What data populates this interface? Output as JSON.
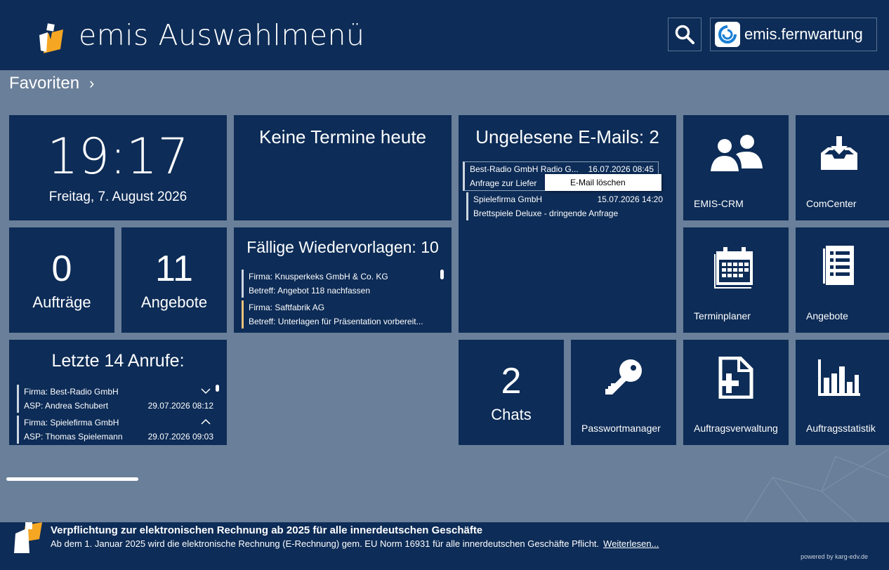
{
  "header": {
    "title": "emis Auswahlmenü",
    "fernwartung_label": "emis.fernwartung"
  },
  "favorites": {
    "label": "Favoriten",
    "chevron": "›"
  },
  "clock": {
    "time": "19:17",
    "date": "Freitag, 7. August 2026"
  },
  "termine": {
    "title": "Keine Termine heute"
  },
  "emails": {
    "title": "Ungelesene E-Mails: 2",
    "items": [
      {
        "from": "Best-Radio GmbH Radio G...",
        "date": "16.07.2026 08:45",
        "subject": "Anfrage zur Liefer"
      },
      {
        "from": "Spielefirma GmbH",
        "date": "15.07.2026 14:20",
        "subject": "Brettspiele Deluxe - dringende Anfrage"
      }
    ],
    "context_menu": "E-Mail löschen"
  },
  "auftraege": {
    "count": "0",
    "label": "Aufträge"
  },
  "angebote_count": {
    "count": "11",
    "label": "Angebote"
  },
  "wiedervorlagen": {
    "title": "Fällige Wiedervorlagen: 10",
    "items": [
      {
        "firma": "Firma: Knusperkeks GmbH & Co. KG",
        "betreff": "Betreff: Angebot 118 nachfassen",
        "color": "#ced6e0"
      },
      {
        "firma": "Firma: Saftfabrik AG",
        "betreff": "Betreff: Unterlagen für Präsentation vorbereit...",
        "color": "#f0c27a"
      }
    ]
  },
  "anrufe": {
    "title": "Letzte 14 Anrufe:",
    "items": [
      {
        "firma": "Firma: Best-Radio GmbH",
        "asp": "ASP: Andrea Schubert",
        "date": "29.07.2026 08:12",
        "chevron": "down"
      },
      {
        "firma": "Firma: Spielefirma GmbH",
        "asp": "ASP: Thomas Spielemann",
        "date": "29.07.2026 09:03",
        "chevron": "up"
      }
    ]
  },
  "chats": {
    "count": "2",
    "label": "Chats"
  },
  "apps": {
    "crm": "EMIS-CRM",
    "comcenter": "ComCenter",
    "terminplaner": "Terminplaner",
    "angebote": "Angebote",
    "passwort": "Passwortmanager",
    "auftragsverwaltung": "Auftragsverwaltung",
    "auftragsstatistik": "Auftragsstatistik"
  },
  "footer": {
    "title": "Verpflichtung zur elektronischen Rechnung ab 2025 für alle innerdeutschen Geschäfte",
    "text": "Ab dem 1. Januar 2025 wird die  elektronische Rechnung (E-Rechnung) gem. EU Norm 16931 für alle innerdeutschen Geschäfte Pflicht.",
    "link": "Weiterlesen...",
    "powered": "powered by karg-edv.de"
  },
  "colors": {
    "background": "#6a7f99",
    "tile": "#0d2c57",
    "accent": "#f5a623"
  }
}
